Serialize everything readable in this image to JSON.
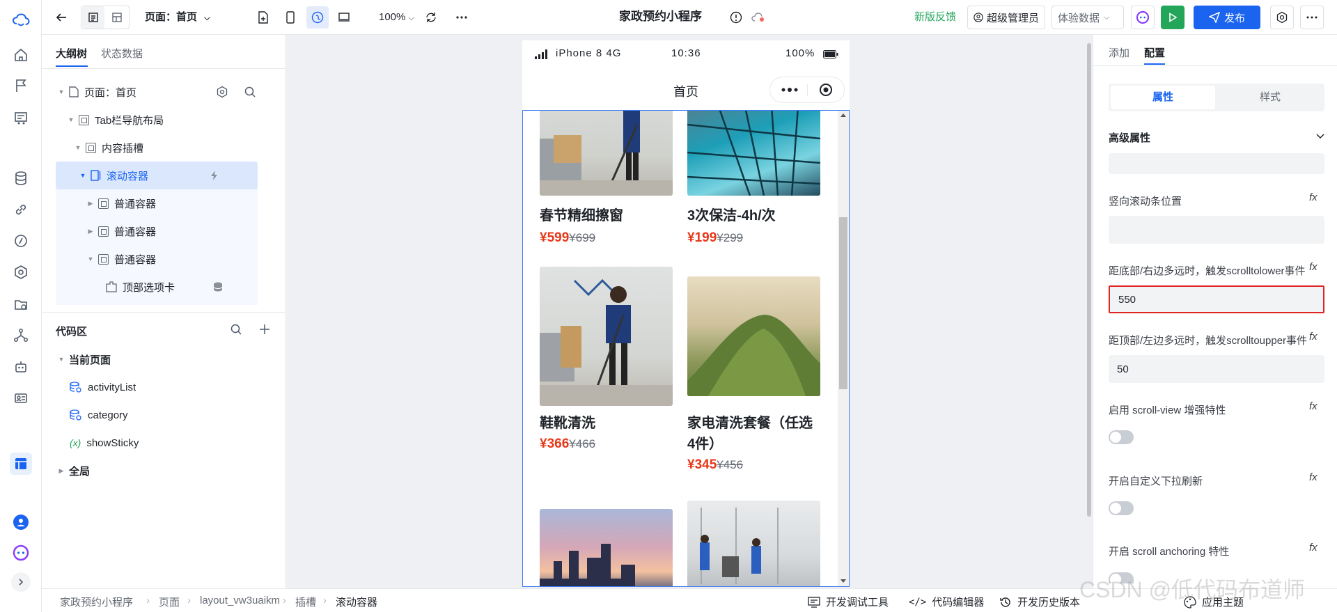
{
  "app": {
    "title": "家政预约小程序"
  },
  "toolbar": {
    "page_label": "页面：首页",
    "zoom": "100%",
    "feedback": "新版反馈",
    "admin": "超级管理员",
    "data_mode": "体验数据",
    "publish": "发布"
  },
  "left_panel": {
    "tabs": [
      "大纲树",
      "状态数据"
    ],
    "tree": [
      {
        "label": "页面：首页"
      },
      {
        "label": "Tab栏导航布局"
      },
      {
        "label": "内容插槽"
      },
      {
        "label": "滚动容器"
      },
      {
        "label": "普通容器"
      },
      {
        "label": "普通容器"
      },
      {
        "label": "普通容器"
      },
      {
        "label": "顶部选项卡"
      }
    ],
    "code_section": {
      "title": "代码区",
      "current_page": "当前页面",
      "items": [
        "activityList",
        "category",
        "showSticky"
      ],
      "global": "全局"
    }
  },
  "phone": {
    "carrier": "iPhone 8  4G",
    "time": "10:36",
    "battery": "100%",
    "nav_title": "首页",
    "cards": [
      {
        "title": "春节精细擦窗",
        "price": "¥599",
        "old_price": "¥699"
      },
      {
        "title": "3次保洁-4h/次",
        "price": "¥199",
        "old_price": "¥299"
      },
      {
        "title": "鞋靴清洗",
        "price": "¥366",
        "old_price": "¥466"
      },
      {
        "title": "家电清洗套餐（任选4件）",
        "price": "¥345",
        "old_price": "¥456"
      }
    ]
  },
  "right_panel": {
    "tabs": [
      "添加",
      "配置"
    ],
    "segments": [
      "属性",
      "样式"
    ],
    "section": "高级属性",
    "fields": [
      {
        "label": "竖向滚动条位置",
        "value": ""
      },
      {
        "label": "距底部/右边多远时，触发scrolltolower事件",
        "value": "550"
      },
      {
        "label": "距顶部/左边多远时，触发scrolltoupper事件",
        "value": "50"
      }
    ],
    "toggles": [
      {
        "label": "启用 scroll-view 增强特性"
      },
      {
        "label": "开启自定义下拉刷新"
      },
      {
        "label": "开启 scroll anchoring 特性"
      }
    ],
    "fx": "fx"
  },
  "bottom": {
    "breadcrumb": [
      "家政预约小程序",
      "页面",
      "layout_vw3uaikm",
      "插槽",
      "滚动容器"
    ],
    "tools": [
      "开发调试工具",
      "代码编辑器",
      "开发历史版本",
      "应用主题"
    ],
    "watermark": "CSDN @低代码布道师"
  }
}
